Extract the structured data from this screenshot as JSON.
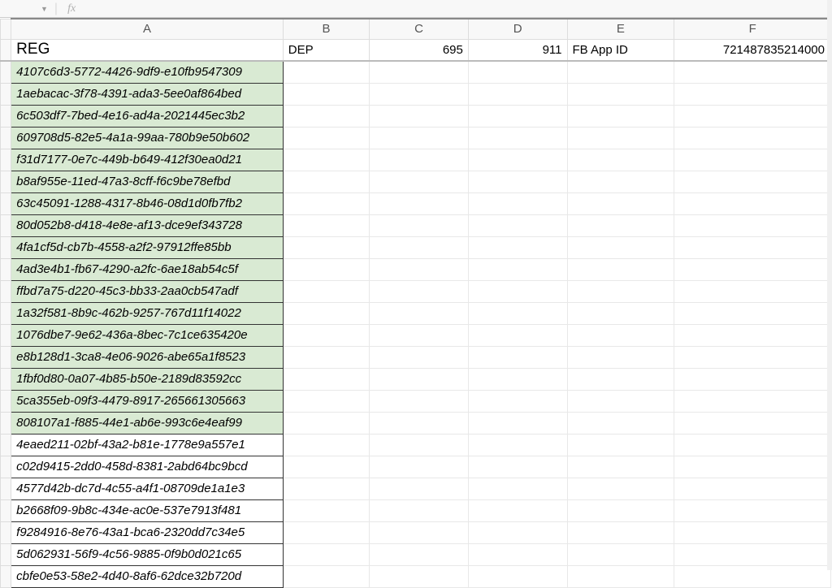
{
  "toolbar": {
    "fx_label": "fx"
  },
  "columns": [
    "A",
    "B",
    "C",
    "D",
    "E",
    "F"
  ],
  "header_row": {
    "a": "REG",
    "b": "DEP",
    "c": "695",
    "d": "911",
    "e": "FB App ID",
    "f": "721487835214000"
  },
  "rows": [
    {
      "a": "4107c6d3-5772-4426-9df9-e10fb9547309",
      "green": true
    },
    {
      "a": "1aebacac-3f78-4391-ada3-5ee0af864bed",
      "green": true
    },
    {
      "a": "6c503df7-7bed-4e16-ad4a-2021445ec3b2",
      "green": true
    },
    {
      "a": "609708d5-82e5-4a1a-99aa-780b9e50b602",
      "green": true
    },
    {
      "a": "f31d7177-0e7c-449b-b649-412f30ea0d21",
      "green": true
    },
    {
      "a": "b8af955e-11ed-47a3-8cff-f6c9be78efbd",
      "green": true
    },
    {
      "a": "63c45091-1288-4317-8b46-08d1d0fb7fb2",
      "green": true
    },
    {
      "a": "80d052b8-d418-4e8e-af13-dce9ef343728",
      "green": true
    },
    {
      "a": "4fa1cf5d-cb7b-4558-a2f2-97912ffe85bb",
      "green": true
    },
    {
      "a": "4ad3e4b1-fb67-4290-a2fc-6ae18ab54c5f",
      "green": true
    },
    {
      "a": "ffbd7a75-d220-45c3-bb33-2aa0cb547adf",
      "green": true
    },
    {
      "a": "1a32f581-8b9c-462b-9257-767d11f14022",
      "green": true
    },
    {
      "a": "1076dbe7-9e62-436a-8bec-7c1ce635420e",
      "green": true
    },
    {
      "a": "e8b128d1-3ca8-4e06-9026-abe65a1f8523",
      "green": true
    },
    {
      "a": "1fbf0d80-0a07-4b85-b50e-2189d83592cc",
      "green": true
    },
    {
      "a": "5ca355eb-09f3-4479-8917-265661305663",
      "green": true
    },
    {
      "a": "808107a1-f885-44e1-ab6e-993c6e4eaf99",
      "green": true
    },
    {
      "a": "4eaed211-02bf-43a2-b81e-1778e9a557e1",
      "green": false
    },
    {
      "a": "c02d9415-2dd0-458d-8381-2abd64bc9bcd",
      "green": false
    },
    {
      "a": "4577d42b-dc7d-4c55-a4f1-08709de1a1e3",
      "green": false
    },
    {
      "a": "b2668f09-9b8c-434e-ac0e-537e7913f481",
      "green": false
    },
    {
      "a": "f9284916-8e76-43a1-bca6-2320dd7c34e5",
      "green": false
    },
    {
      "a": "5d062931-56f9-4c56-9885-0f9b0d021c65",
      "green": false
    },
    {
      "a": "cbfe0e53-58e2-4d40-8af6-62dce32b720d",
      "green": false
    }
  ]
}
